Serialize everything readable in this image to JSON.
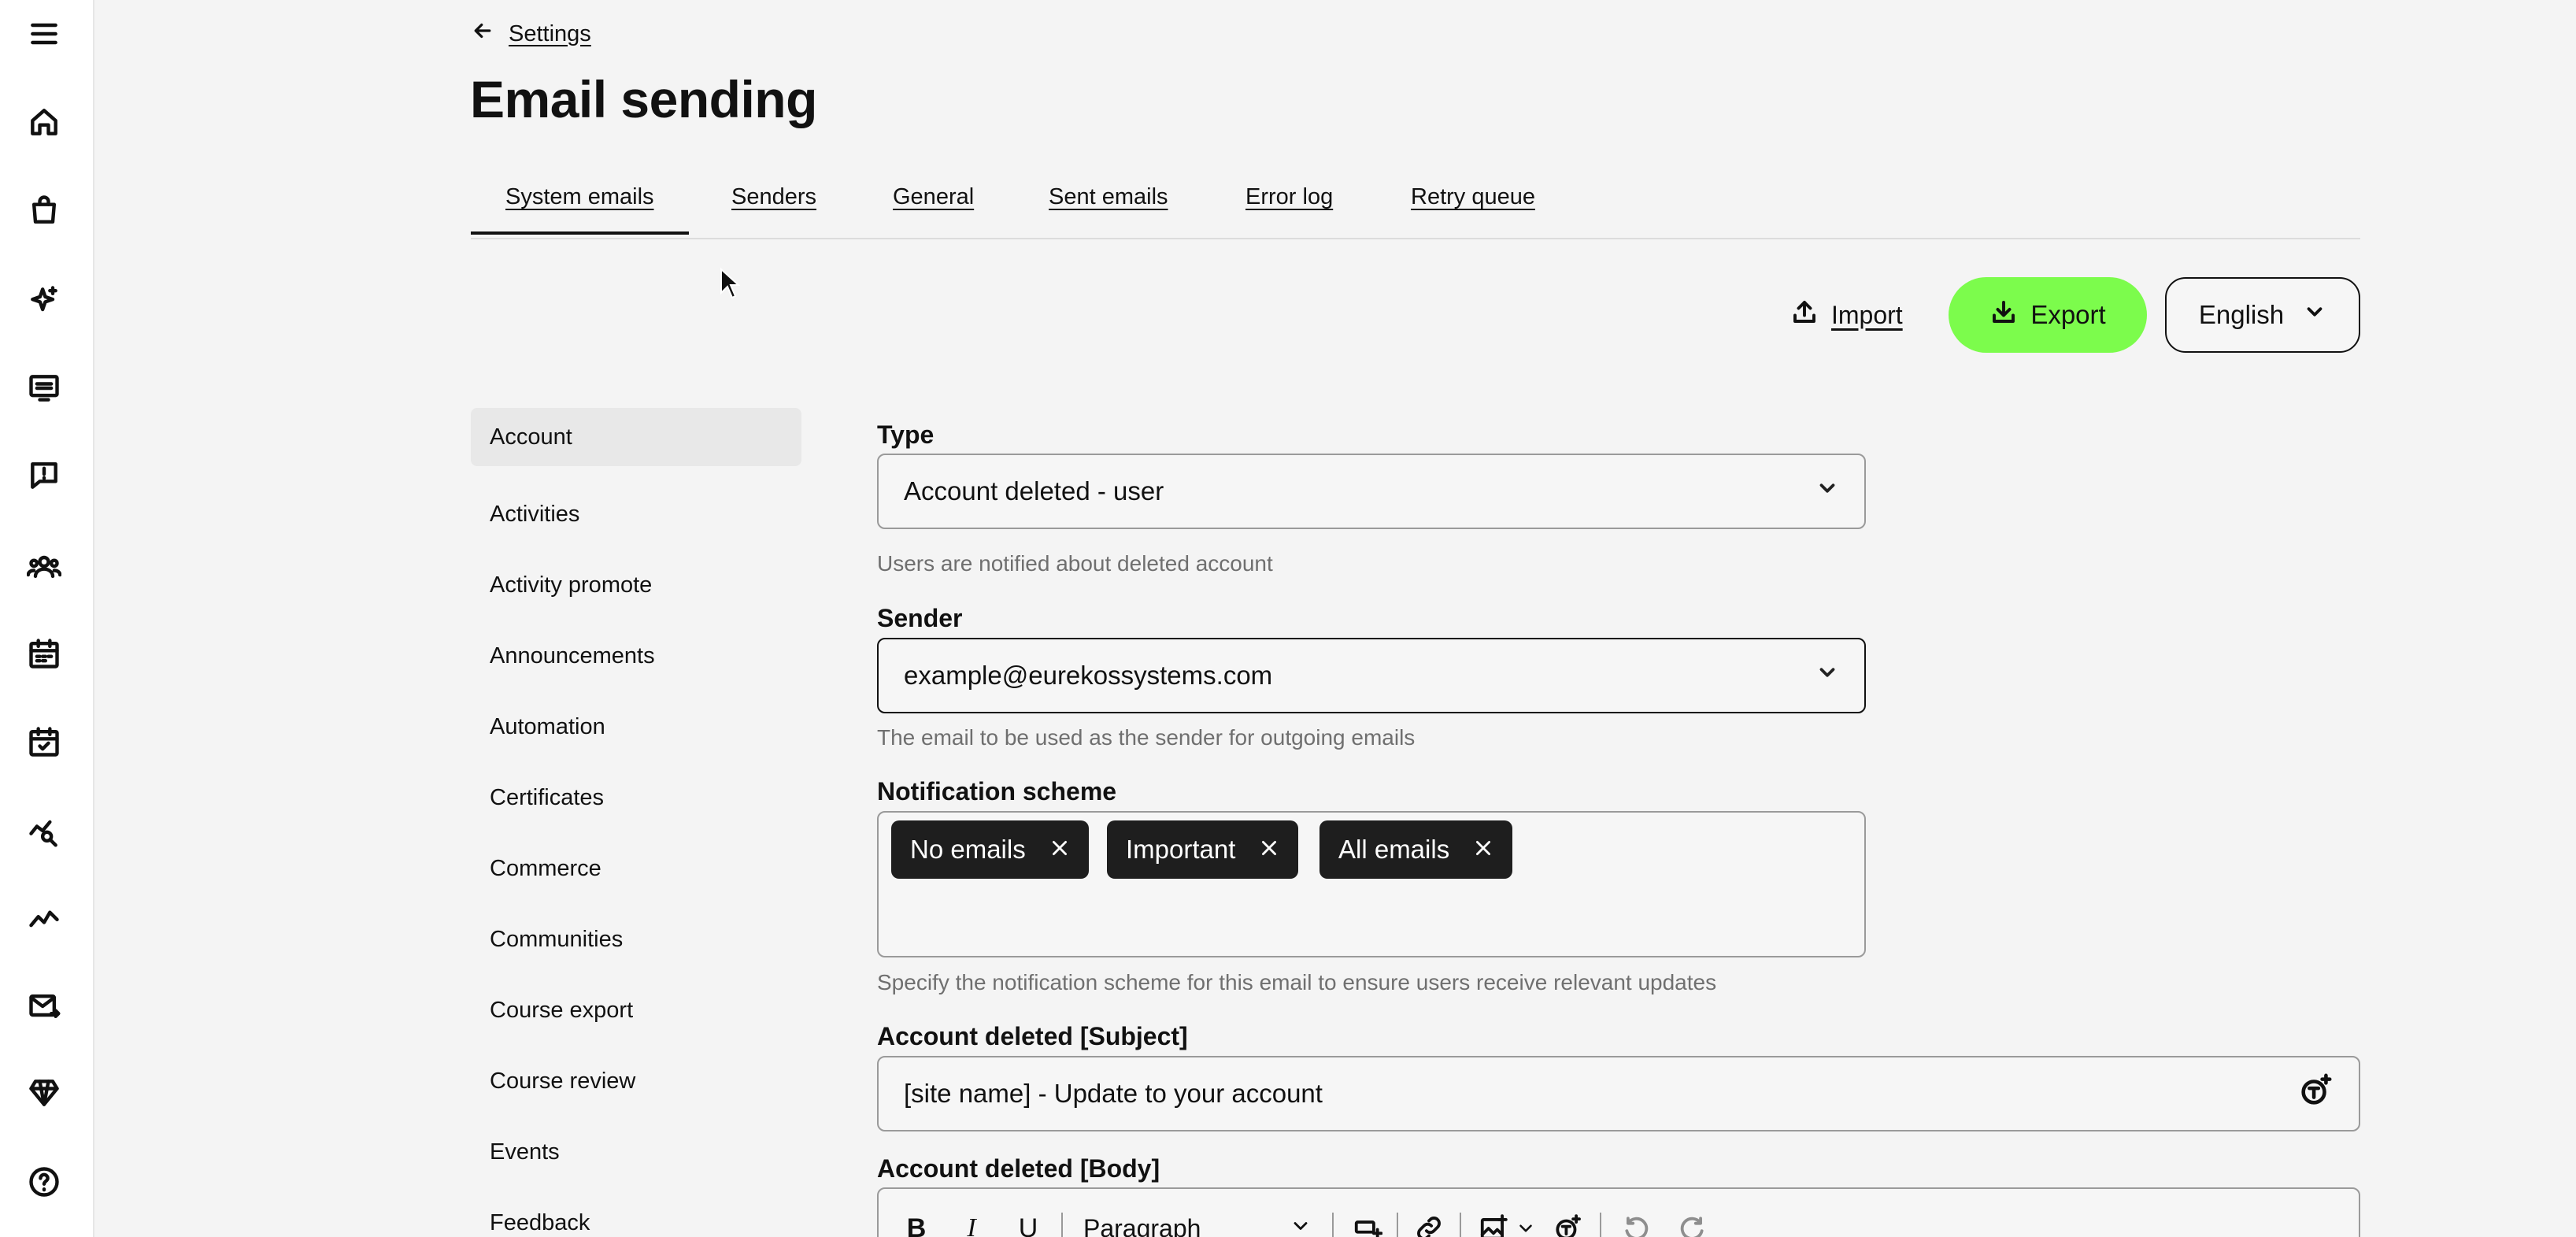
{
  "rail": {
    "icons": [
      "menu-icon",
      "home-icon",
      "shopping-bag-icon",
      "sparkles-icon",
      "monitor-icon",
      "chat-alert-icon",
      "users-icon",
      "calendar-icon",
      "calendar-check-icon",
      "chart-search-icon",
      "trend-line-icon",
      "mail-send-icon",
      "diamond-icon",
      "help-icon"
    ]
  },
  "header": {
    "breadcrumb": "Settings",
    "title": "Email sending"
  },
  "tabs": [
    {
      "label": "System emails",
      "active": true
    },
    {
      "label": "Senders"
    },
    {
      "label": "General"
    },
    {
      "label": "Sent emails"
    },
    {
      "label": "Error log"
    },
    {
      "label": "Retry queue"
    }
  ],
  "toolbar": {
    "import_label": "Import",
    "export_label": "Export",
    "language": "English",
    "export_color": "#7cfc4c"
  },
  "categories": [
    "Account",
    "Activities",
    "Activity promote",
    "Announcements",
    "Automation",
    "Certificates",
    "Commerce",
    "Communities",
    "Course export",
    "Course review",
    "Events",
    "Feedback"
  ],
  "form": {
    "type": {
      "label": "Type",
      "value": "Account deleted - user",
      "help": "Users are notified about deleted account"
    },
    "sender": {
      "label": "Sender",
      "value": "example@eurekossystems.com",
      "help": "The email to be used as the sender for outgoing emails"
    },
    "notification": {
      "label": "Notification scheme",
      "tags": [
        "No emails",
        "Important",
        "All emails"
      ],
      "help": "Specify the notification scheme for this email to ensure users receive relevant updates"
    },
    "subject": {
      "label": "Account deleted [Subject]",
      "value": "[site name] - Update to your account"
    },
    "body": {
      "label": "Account deleted [Body]",
      "toolbar": {
        "bold": "B",
        "italic": "I",
        "underline": "U",
        "block_format": "Paragraph"
      }
    }
  }
}
